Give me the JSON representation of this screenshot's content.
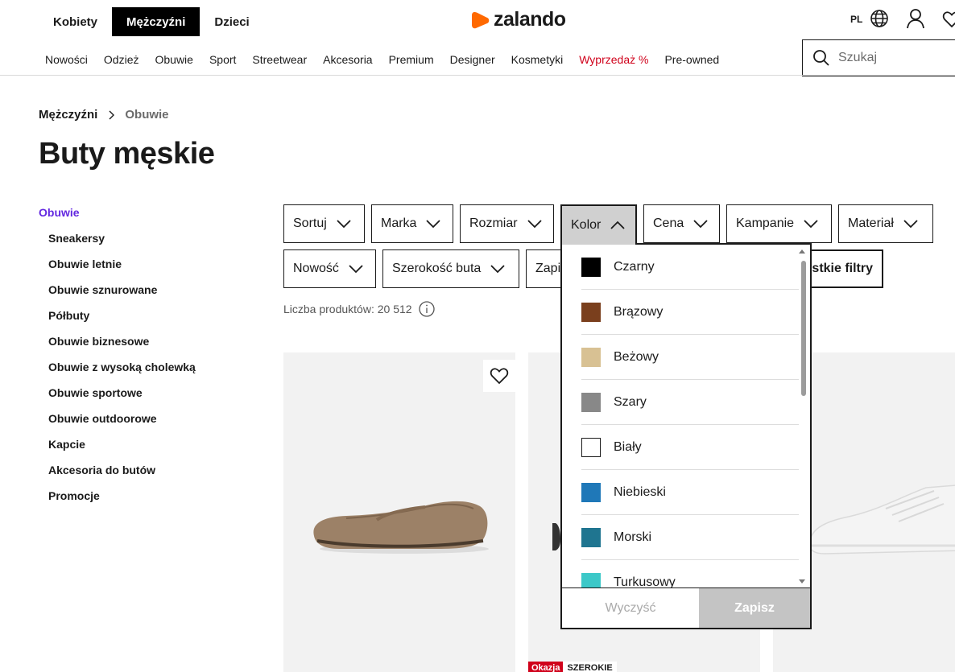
{
  "header": {
    "gender_tabs": [
      {
        "label": "Kobiety",
        "active": false
      },
      {
        "label": "Mężczyźni",
        "active": true
      },
      {
        "label": "Dzieci",
        "active": false
      }
    ],
    "logo_text": "zalando",
    "logo_color": "#ff6900",
    "language": "PL",
    "icons": [
      "globe-icon",
      "user-icon",
      "heart-icon"
    ]
  },
  "nav": {
    "items": [
      "Nowości",
      "Odzież",
      "Obuwie",
      "Sport",
      "Streetwear",
      "Akcesoria",
      "Premium",
      "Designer",
      "Kosmetyki",
      "Wyprzedaż %",
      "Pre-owned"
    ],
    "sale_color": "#d0021b"
  },
  "search": {
    "placeholder": "Szukaj",
    "value": ""
  },
  "breadcrumb": [
    "Mężczyźni",
    "Obuwie"
  ],
  "page_title": "Buty męskie",
  "sidebar": {
    "heading": "Obuwie",
    "heading_color": "#6328e0",
    "items": [
      "Sneakersy",
      "Obuwie letnie",
      "Obuwie sznurowane",
      "Półbuty",
      "Obuwie biznesowe",
      "Obuwie z wysoką cholewką",
      "Obuwie sportowe",
      "Obuwie outdoorowe",
      "Kapcie",
      "Akcesoria do butów",
      "Promocje"
    ]
  },
  "filters": {
    "sort": "Sortuj",
    "brand": "Marka",
    "size": "Rozmiar",
    "color": "Kolor",
    "price": "Cena",
    "campaigns": "Kampanie",
    "material": "Materiał",
    "newness": "Nowość",
    "shoe_width": "Szerokość buta",
    "partial": "Zapi",
    "all_filters": "ystkie filtry"
  },
  "product_count": "Liczba produktów: 20 512",
  "color_dropdown": {
    "options": [
      {
        "label": "Czarny",
        "color": "#000000"
      },
      {
        "label": "Brązowy",
        "color": "#7a3f1d"
      },
      {
        "label": "Beżowy",
        "color": "#d8c193"
      },
      {
        "label": "Szary",
        "color": "#888888"
      },
      {
        "label": "Biały",
        "color": "#ffffff"
      },
      {
        "label": "Niebieski",
        "color": "#1f78b8"
      },
      {
        "label": "Morski",
        "color": "#1f7590"
      },
      {
        "label": "Turkusowy",
        "color": "#3cc8c8"
      }
    ],
    "clear_label": "Wyczyść",
    "save_label": "Zapisz"
  },
  "products": {
    "badges": [
      "Okazja",
      "SZEROKIE"
    ]
  }
}
